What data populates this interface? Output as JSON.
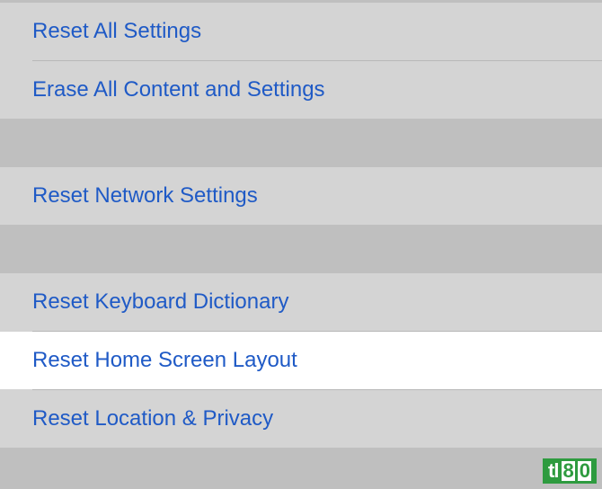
{
  "groups": [
    {
      "rows": [
        {
          "id": "reset-all-settings",
          "label": "Reset All Settings",
          "highlighted": false
        },
        {
          "id": "erase-all",
          "label": "Erase All Content and Settings",
          "highlighted": false
        }
      ]
    },
    {
      "rows": [
        {
          "id": "reset-network",
          "label": "Reset Network Settings",
          "highlighted": false
        }
      ]
    },
    {
      "rows": [
        {
          "id": "reset-keyboard",
          "label": "Reset Keyboard Dictionary",
          "highlighted": false
        },
        {
          "id": "reset-home-screen",
          "label": "Reset Home Screen Layout",
          "highlighted": true
        },
        {
          "id": "reset-location-privacy",
          "label": "Reset Location & Privacy",
          "highlighted": false
        }
      ]
    }
  ],
  "watermark": {
    "prefix": "tl",
    "d1": "8",
    "d2": "0"
  }
}
